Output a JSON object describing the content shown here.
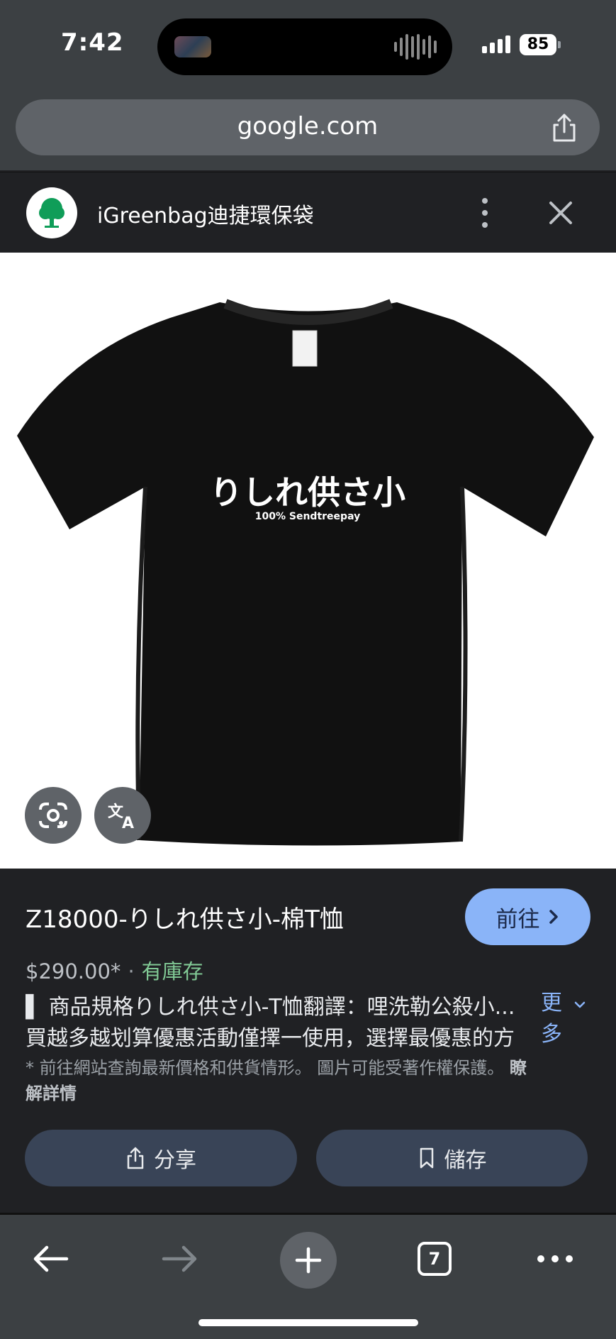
{
  "status_bar": {
    "time": "7:42",
    "battery": "85"
  },
  "browser": {
    "url": "google.com"
  },
  "tab_header": {
    "site_title": "iGreenbag迪捷環保袋"
  },
  "image": {
    "shirt_text_main": "りしれ供さ小",
    "shirt_text_sub": "100% Sendtreepay"
  },
  "product": {
    "title": "Z18000-りしれ供さ小-棉T恤",
    "go_label": "前往",
    "price": "$290.00*",
    "separator": "·",
    "stock": "有庫存",
    "description_line1": "▌ 商品規格りしれ供さ小-T恤翻譯：哩洗勒公殺小...",
    "description_line2": "買越多越划算優惠活動僅擇一使用，選擇最優惠的方",
    "more_label_1": "更",
    "more_label_2": "多",
    "note": "* 前往網站查詢最新價格和供貨情形。 圖片可能受著作權保護。",
    "note_link_1": "瞭",
    "note_link_2": "解詳情",
    "share_label": "分享",
    "save_label": "儲存"
  },
  "bottom_nav": {
    "tab_count": "7"
  },
  "colors": {
    "accent": "#8ab4f8",
    "in_stock": "#81c995",
    "button_bg": "#394457",
    "toolbar_bg": "#3c4043"
  }
}
